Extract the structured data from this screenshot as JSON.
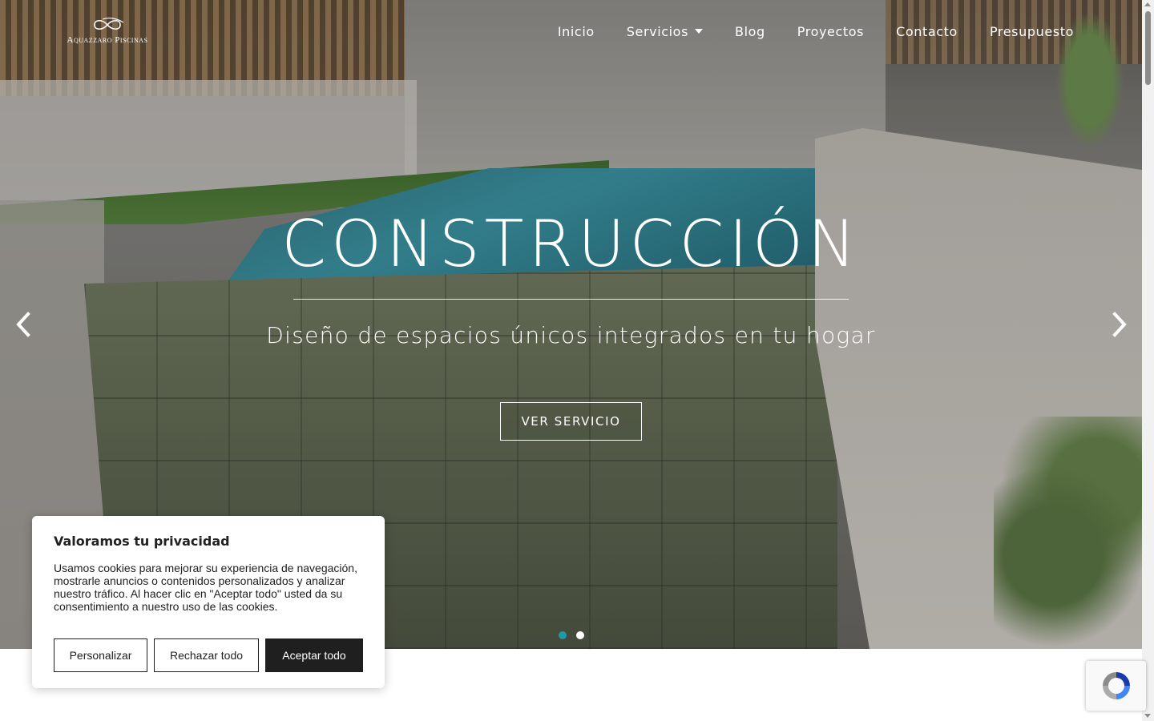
{
  "brand": {
    "logo_text": "Aquazzaro Piscinas"
  },
  "nav": {
    "items": [
      {
        "label": "Inicio"
      },
      {
        "label": "Servicios",
        "has_dropdown": true
      },
      {
        "label": "Blog"
      },
      {
        "label": "Proyectos"
      },
      {
        "label": "Contacto"
      },
      {
        "label": "Presupuesto"
      }
    ]
  },
  "hero": {
    "title": "CONSTRUCCIÓN",
    "subtitle": "Diseño de espacios únicos integrados en tu hogar",
    "cta_label": "VER SERVICIO",
    "prev_icon": "chevron-left-icon",
    "next_icon": "chevron-right-icon",
    "slides_total": 2,
    "active_slide": 1,
    "active_dot_color": "#1f9aa6"
  },
  "cookie_banner": {
    "title": "Valoramos tu privacidad",
    "text": "Usamos cookies para mejorar su experiencia de navegación, mostrarle anuncios o contenidos personalizados y analizar nuestro tráfico. Al hacer clic en \"Aceptar todo\" usted da su consentimiento a nuestro uso de las cookies.",
    "buttons": {
      "customize": "Personalizar",
      "reject": "Rechazar todo",
      "accept": "Aceptar todo"
    }
  },
  "recaptcha": {
    "icon": "recaptcha-icon"
  }
}
